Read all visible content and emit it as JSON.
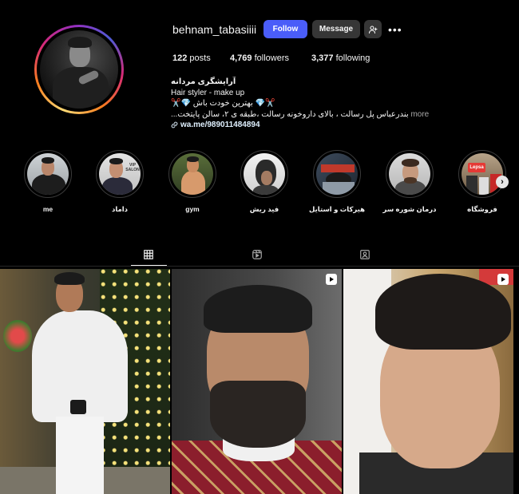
{
  "profile": {
    "username": "behnam_tabasiiii",
    "follow_label": "Follow",
    "message_label": "Message",
    "stats": {
      "posts_count": "122",
      "posts_label": "posts",
      "followers_count": "4,769",
      "followers_label": "followers",
      "following_count": "3,377",
      "following_label": "following"
    },
    "bio": {
      "name": "آرایشگری مردانه",
      "line1": "Hair styler - make up",
      "line2": "✂️💎 بهترین خودت باش 💎✂️",
      "line3": "...بندرعباس پل رسالت ، بالای داروخونه رسالت ،طبقه ی ۲، سالن پایتخت",
      "more": "more",
      "link": "wa.me/989011484894"
    }
  },
  "highlights": [
    {
      "label": "me"
    },
    {
      "label": "داماد"
    },
    {
      "label": "gym"
    },
    {
      "label": "فید ریش"
    },
    {
      "label": "هیرکات و استایل"
    },
    {
      "label": "درمان شوره سر"
    },
    {
      "label": "فروشگاه"
    }
  ],
  "highlight_text": {
    "vip_badge": "VIP SALON",
    "store_badge": "Lepsa"
  },
  "tabs": [
    "posts-grid-icon",
    "reels-icon",
    "tagged-icon"
  ],
  "colors": {
    "follow": "#4a5df9",
    "secondary_button": "#363636",
    "background": "#000000"
  }
}
